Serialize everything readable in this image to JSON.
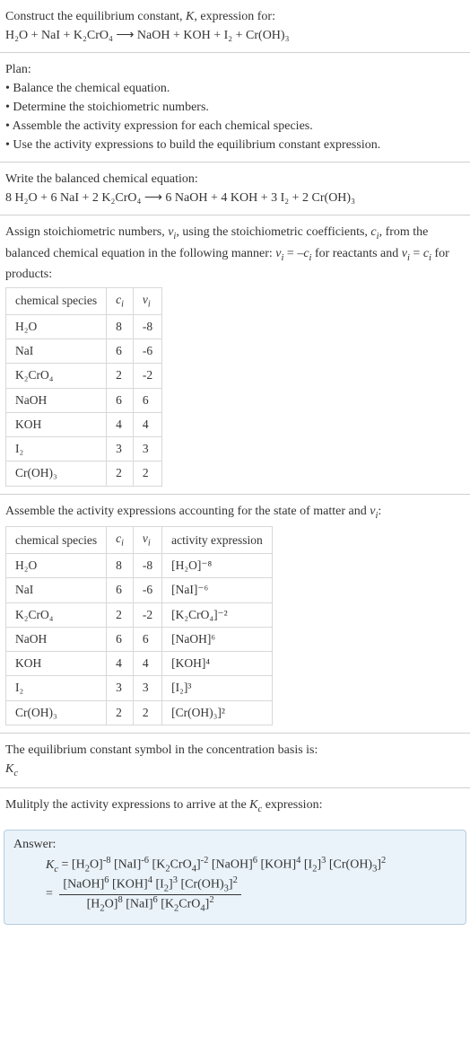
{
  "intro": {
    "line1": "Construct the equilibrium constant, K, expression for:",
    "reaction_unbalanced": "H₂O + NaI + K₂CrO₄  ⟶  NaOH + KOH + I₂ + Cr(OH)₃"
  },
  "plan": {
    "heading": "Plan:",
    "items": [
      "• Balance the chemical equation.",
      "• Determine the stoichiometric numbers.",
      "• Assemble the activity expression for each chemical species.",
      "• Use the activity expressions to build the equilibrium constant expression."
    ]
  },
  "balanced": {
    "heading": "Write the balanced chemical equation:",
    "equation": "8 H₂O + 6 NaI + 2 K₂CrO₄  ⟶  6 NaOH + 4 KOH + 3 I₂ + 2 Cr(OH)₃"
  },
  "stoich": {
    "text_a": "Assign stoichiometric numbers, νᵢ, using the stoichiometric coefficients, cᵢ, from the balanced chemical equation in the following manner: νᵢ = –cᵢ for reactants and νᵢ = cᵢ for products:",
    "headers": [
      "chemical species",
      "cᵢ",
      "νᵢ"
    ],
    "rows": [
      {
        "species": "H₂O",
        "c": "8",
        "v": "-8"
      },
      {
        "species": "NaI",
        "c": "6",
        "v": "-6"
      },
      {
        "species": "K₂CrO₄",
        "c": "2",
        "v": "-2"
      },
      {
        "species": "NaOH",
        "c": "6",
        "v": "6"
      },
      {
        "species": "KOH",
        "c": "4",
        "v": "4"
      },
      {
        "species": "I₂",
        "c": "3",
        "v": "3"
      },
      {
        "species": "Cr(OH)₃",
        "c": "2",
        "v": "2"
      }
    ]
  },
  "activity": {
    "heading": "Assemble the activity expressions accounting for the state of matter and νᵢ:",
    "headers": [
      "chemical species",
      "cᵢ",
      "νᵢ",
      "activity expression"
    ],
    "rows": [
      {
        "species": "H₂O",
        "c": "8",
        "v": "-8",
        "expr": "[H₂O]⁻⁸"
      },
      {
        "species": "NaI",
        "c": "6",
        "v": "-6",
        "expr": "[NaI]⁻⁶"
      },
      {
        "species": "K₂CrO₄",
        "c": "2",
        "v": "-2",
        "expr": "[K₂CrO₄]⁻²"
      },
      {
        "species": "NaOH",
        "c": "6",
        "v": "6",
        "expr": "[NaOH]⁶"
      },
      {
        "species": "KOH",
        "c": "4",
        "v": "4",
        "expr": "[KOH]⁴"
      },
      {
        "species": "I₂",
        "c": "3",
        "v": "3",
        "expr": "[I₂]³"
      },
      {
        "species": "Cr(OH)₃",
        "c": "2",
        "v": "2",
        "expr": "[Cr(OH)₃]²"
      }
    ]
  },
  "kc_symbol": {
    "line1": "The equilibrium constant symbol in the concentration basis is:",
    "line2": "K𝑐"
  },
  "multiply": {
    "heading": "Mulitply the activity expressions to arrive at the K𝑐 expression:"
  },
  "answer": {
    "label": "Answer:",
    "line1": "K𝑐 = [H₂O]⁻⁸ [NaI]⁻⁶ [K₂CrO₄]⁻² [NaOH]⁶ [KOH]⁴ [I₂]³ [Cr(OH)₃]²",
    "eq_sign": "=",
    "frac_num": "[NaOH]⁶ [KOH]⁴ [I₂]³ [Cr(OH)₃]²",
    "frac_den": "[H₂O]⁸ [NaI]⁶ [K₂CrO₄]²"
  }
}
